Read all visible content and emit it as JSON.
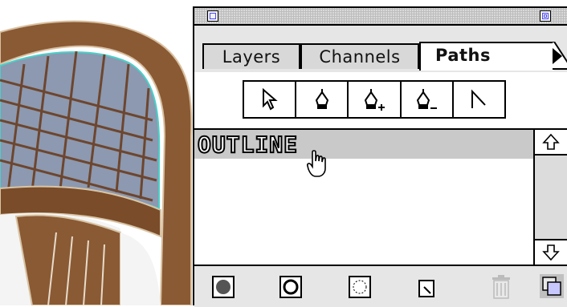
{
  "palette": {
    "tabs": [
      {
        "label": "Layers"
      },
      {
        "label": "Channels"
      },
      {
        "label": "Paths"
      }
    ],
    "tools": [
      {
        "icon": "arrow-select-icon"
      },
      {
        "icon": "pen-icon"
      },
      {
        "icon": "add-anchor-pen-icon"
      },
      {
        "icon": "delete-anchor-pen-icon"
      },
      {
        "icon": "convert-anchor-icon"
      }
    ],
    "paths": [
      {
        "name": "OUTLINE"
      }
    ],
    "bottom_buttons": [
      {
        "icon": "fill-path-icon"
      },
      {
        "icon": "stroke-path-icon"
      },
      {
        "icon": "load-selection-icon"
      },
      {
        "icon": "make-work-path-icon"
      },
      {
        "icon": "trash-icon"
      }
    ]
  },
  "colors": {
    "accent": "#4b4bff",
    "selected_row": "#c9c9c9",
    "panel": "#e6e6e6"
  }
}
